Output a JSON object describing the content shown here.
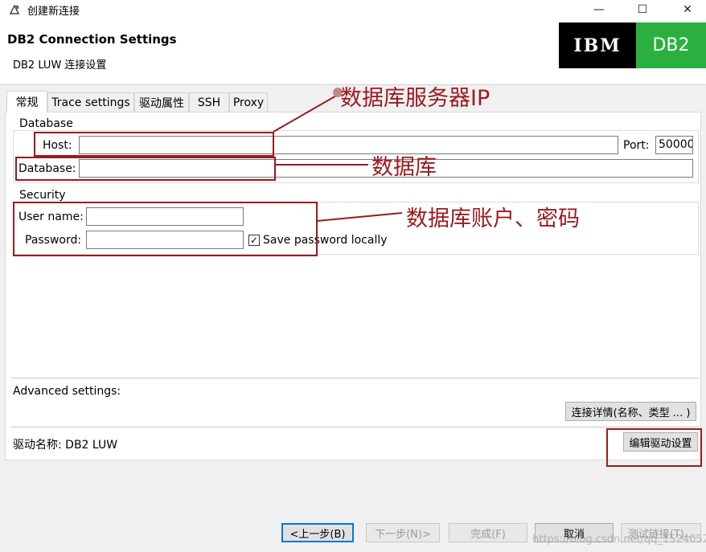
{
  "window": {
    "title": "创建新连接",
    "minimize_glyph": "—",
    "maximize_glyph": "☐",
    "close_glyph": "✕",
    "app_icon": "connection-wizard-icon"
  },
  "header": {
    "title": "DB2 Connection Settings",
    "subtitle": "DB2 LUW 连接设置",
    "logo_ibm": "IBM",
    "logo_db2": "DB2",
    "db2_color": "#2bb040"
  },
  "tabs": [
    {
      "label": "常规",
      "active": true
    },
    {
      "label": "Trace settings",
      "active": false
    },
    {
      "label": "驱动属性",
      "active": false
    },
    {
      "label": "SSH",
      "active": false
    },
    {
      "label": "Proxy",
      "active": false
    }
  ],
  "database_group": {
    "label": "Database",
    "host_label": "Host:",
    "host_value": "",
    "port_label": "Port:",
    "port_value": "50000",
    "database_label": "Database:",
    "database_value": ""
  },
  "security_group": {
    "label": "Security",
    "username_label": "User name:",
    "username_value": "",
    "password_label": "Password:",
    "password_value": "",
    "save_password_label": "Save password locally",
    "save_password_checked": true
  },
  "advanced": {
    "label": "Advanced settings:",
    "details_button": "连接详情(名称、类型 ... )"
  },
  "driver": {
    "label": "驱动名称: DB2 LUW",
    "edit_button": "编辑驱动设置"
  },
  "footer": {
    "back": "<上一步(B)",
    "next": "下一步(N)>",
    "finish": "完成(F)",
    "cancel": "取消",
    "test": "测试链接(T)..."
  },
  "annotations": {
    "server_ip": "数据库服务器IP",
    "database": "数据库",
    "account": "数据库账户、密码",
    "color": "#9b1a1f"
  },
  "watermark": "https://blog.csdn.net/qq_1524052"
}
